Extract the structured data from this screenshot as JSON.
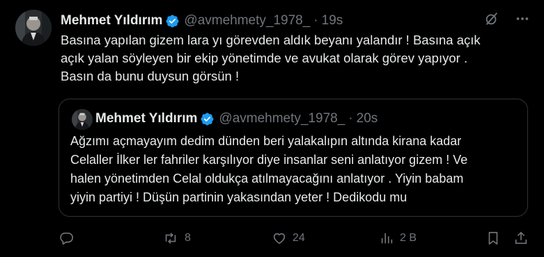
{
  "tweet": {
    "author_name": "Mehmet Yıldırım",
    "handle": "@avmehmety_1978_",
    "separator": "·",
    "time": "19s",
    "text": "Basına  yapılan gizem lara yı görevden aldık beyanı yalandır ! Basına  açık\naçık yalan söyleyen bir ekip yönetimde ve avukat olarak görev yapıyor .\nBasın da  bunu duysun görsün !"
  },
  "quoted_tweet": {
    "author_name": "Mehmet Yıldırım",
    "handle": "@avmehmety_1978_",
    "separator": "·",
    "time": "20s",
    "text": "Ağzımı açmayayım dedim dünden beri yalakalıpın altında kirana kadar\nCelaller İlker ler fahriler karşılıyor diye insanlar seni anlatıyor gizem ! Ve\nhalen yönetimden Celal oldukça atılmayacağını anlatıyor . Yiyin babam\nyiyin partiyi !  Düşün partinin yakasından yeter ! Dedikodu mu"
  },
  "actions": {
    "replies": "",
    "reposts": "8",
    "likes": "24",
    "views": "2 B"
  },
  "icons": {
    "verified": "verified-badge-icon",
    "grok": "grok-icon",
    "more": "more-icon",
    "reply": "reply-icon",
    "repost": "repost-icon",
    "like": "heart-icon",
    "views": "views-icon",
    "bookmark": "bookmark-icon",
    "share": "share-icon"
  },
  "colors": {
    "background": "#000000",
    "text": "#e7e9ea",
    "muted": "#71767b",
    "verified": "#1d9bf0",
    "border": "#2f3336"
  }
}
